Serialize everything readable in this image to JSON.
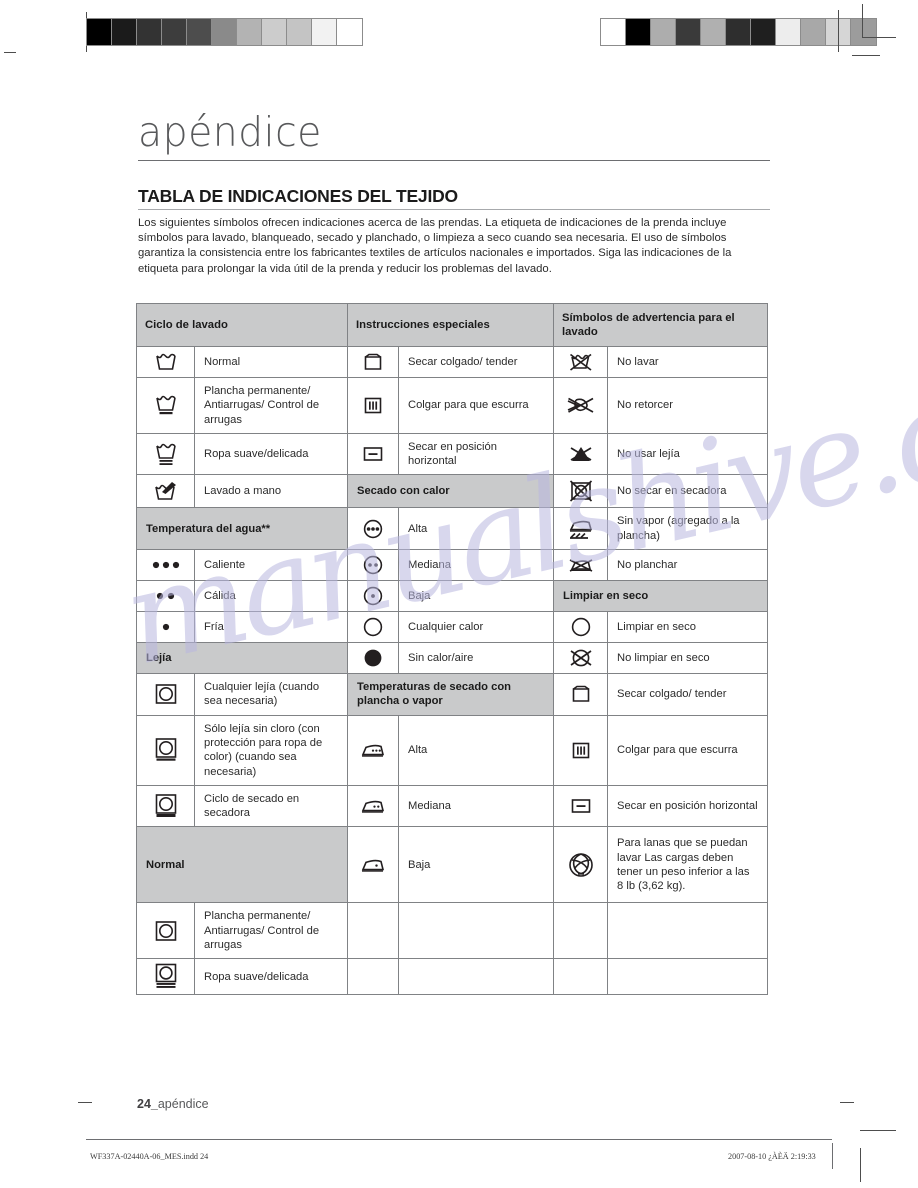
{
  "chapter": {
    "title": "apéndice"
  },
  "section": {
    "heading": "TABLA DE INDICACIONES DEL TEJIDO"
  },
  "intro": {
    "text": "Los siguientes símbolos ofrecen indicaciones acerca de las prendas. La etiqueta de indicaciones de la prenda incluye símbolos para lavado, blanqueado, secado y planchado, o limpieza a seco cuando sea necesaria. El uso de símbolos garantiza la consistencia entre los fabricantes textiles de artículos nacionales e importados. Siga las indicaciones de la etiqueta para prolongar la vida útil de la prenda y reducir los problemas del lavado."
  },
  "table": {
    "headers": {
      "col1": "Ciclo de lavado",
      "col2": "Instrucciones especiales",
      "col3": "Símbolos de advertencia para el lavado"
    },
    "col1": [
      {
        "icon": "wash-tub-icon",
        "label": "Normal"
      },
      {
        "icon": "wash-tub-one-bar-icon",
        "label": "Plancha permanente/ Antiarrugas/ Control de arrugas"
      },
      {
        "icon": "wash-tub-two-bar-icon",
        "label": "Ropa suave/delicada"
      },
      {
        "icon": "hand-wash-icon",
        "label": "Lavado a mano"
      },
      {
        "subheader": "Temperatura del agua**"
      },
      {
        "icon": "three-dots-icon",
        "label": "Caliente"
      },
      {
        "icon": "two-dots-icon",
        "label": "Cálida"
      },
      {
        "icon": "one-dot-icon",
        "label": "Fría"
      },
      {
        "subheader": "Lejía"
      },
      {
        "icon": "dryer-icon",
        "label": "Cualquier lejía (cuando sea necesaria)"
      },
      {
        "icon": "dryer-one-bar-icon",
        "label": "Sólo lejía sin cloro (con protección para ropa de color)\n(cuando sea necesaria)"
      },
      {
        "icon": "dryer-bold-bar-icon",
        "label": "Ciclo de secado en secadora"
      },
      {
        "subheader": "Normal"
      },
      {
        "icon": "dryer-icon",
        "label": "Plancha permanente/ Antiarrugas/ Control de arrugas"
      },
      {
        "icon": "dryer-two-bar-icon",
        "label": "Ropa suave/delicada"
      }
    ],
    "col2": [
      {
        "icon": "drip-dry-icon",
        "label": "Secar colgado/ tender"
      },
      {
        "icon": "hang-to-dry-icon",
        "label": "Colgar para que escurra"
      },
      {
        "icon": "dry-flat-icon",
        "label": "Secar en posición horizontal"
      },
      {
        "subheader": "Secado con calor"
      },
      {
        "icon": "circle-three-dots-icon",
        "label": "Alta"
      },
      {
        "icon": "circle-two-dots-icon",
        "label": "Mediana"
      },
      {
        "icon": "circle-one-dot-icon",
        "label": "Baja"
      },
      {
        "icon": "circle-empty-icon",
        "label": "Cualquier calor"
      },
      {
        "icon": "circle-filled-icon",
        "label": "Sin calor/aire"
      },
      {
        "subheader": "Temperaturas de secado con plancha o vapor"
      },
      {
        "icon": "iron-three-dots-icon",
        "label": "Alta"
      },
      {
        "icon": "iron-two-dots-icon",
        "label": "Mediana"
      },
      {
        "icon": "iron-one-dot-icon",
        "label": "Baja"
      },
      {
        "icon": "",
        "label": ""
      },
      {
        "icon": "",
        "label": ""
      }
    ],
    "col3": [
      {
        "icon": "do-not-wash-icon",
        "label": "No lavar"
      },
      {
        "icon": "do-not-wring-icon",
        "label": "No retorcer"
      },
      {
        "icon": "do-not-bleach-icon",
        "label": "No usar lejía"
      },
      {
        "icon": "do-not-tumble-dry-icon",
        "label": "No secar en secadora"
      },
      {
        "icon": "no-steam-icon",
        "label": "Sin vapor (agregado a la plancha)"
      },
      {
        "icon": "do-not-iron-icon",
        "label": "No planchar"
      },
      {
        "subheader": "Limpiar en seco"
      },
      {
        "icon": "dry-clean-icon",
        "label": "Limpiar en seco"
      },
      {
        "icon": "do-not-dry-clean-icon",
        "label": "No limpiar en seco"
      },
      {
        "icon": "drip-dry-icon",
        "label": "Secar colgado/ tender"
      },
      {
        "icon": "hang-to-dry-icon",
        "label": "Colgar para que escurra"
      },
      {
        "icon": "dry-flat-icon",
        "label": "Secar en posición horizontal"
      },
      {
        "icon": "wool-icon",
        "label": "Para lanas que se puedan lavar Las cargas deben tener un peso inferior a las 8 lb (3,62 kg)."
      },
      {
        "icon": "",
        "label": ""
      },
      {
        "icon": "",
        "label": ""
      }
    ]
  },
  "watermark": {
    "text": "manualshive.com"
  },
  "footer": {
    "folio_number": "24_",
    "folio_label": "apéndice",
    "file_id": "WF337A-02440A-06_MES.indd   24",
    "timestamp": "2007-08-10   ¿ÀÈÄ 2:19:33"
  },
  "colorbars": {
    "left": [
      "#000000",
      "#1b1b1b",
      "#333333",
      "#3d3d3d",
      "#4d4d4d",
      "#8a8a8a",
      "#b3b3b3",
      "#cccccc",
      "#c4c4c4",
      "#f2f2f2",
      "#ffffff"
    ],
    "right": [
      "#ffffff",
      "#000000",
      "#adadad",
      "#3a3a3a",
      "#b0b0b0",
      "#2e2e2e",
      "#1f1f1f",
      "#ededed",
      "#a8a8a8",
      "#d6d6d6",
      "#9c9c9c"
    ]
  }
}
